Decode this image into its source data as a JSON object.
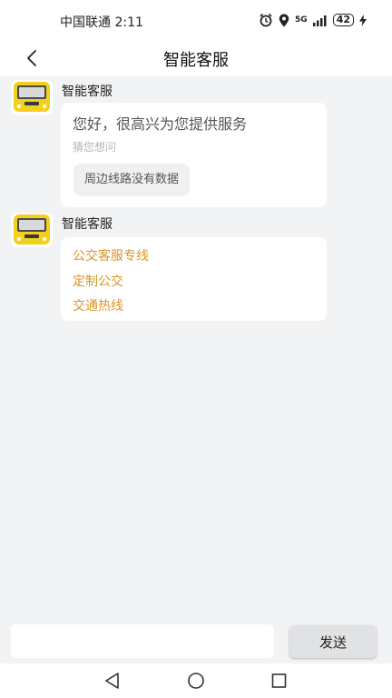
{
  "status_bar": {
    "carrier_time": "中国联通 2:11",
    "network": "5G",
    "battery": "42"
  },
  "header": {
    "title": "智能客服"
  },
  "messages": [
    {
      "sender": "智能客服",
      "greeting": "您好，很高兴为您提供服务",
      "guess_label": "猜您想问",
      "suggestion": "周边线路没有数据"
    },
    {
      "sender": "智能客服",
      "links": [
        "公交客服专线",
        "定制公交",
        "交通热线"
      ]
    }
  ],
  "input_bar": {
    "placeholder": "",
    "send_label": "发送"
  },
  "colors": {
    "link": "#d9952b",
    "avatar_bus": "#f3cf1e"
  },
  "icons": [
    "back-arrow-icon",
    "alarm-icon",
    "location-icon",
    "signal-icon",
    "battery-icon",
    "charging-icon",
    "nav-back-icon",
    "nav-home-icon",
    "nav-recents-icon"
  ]
}
